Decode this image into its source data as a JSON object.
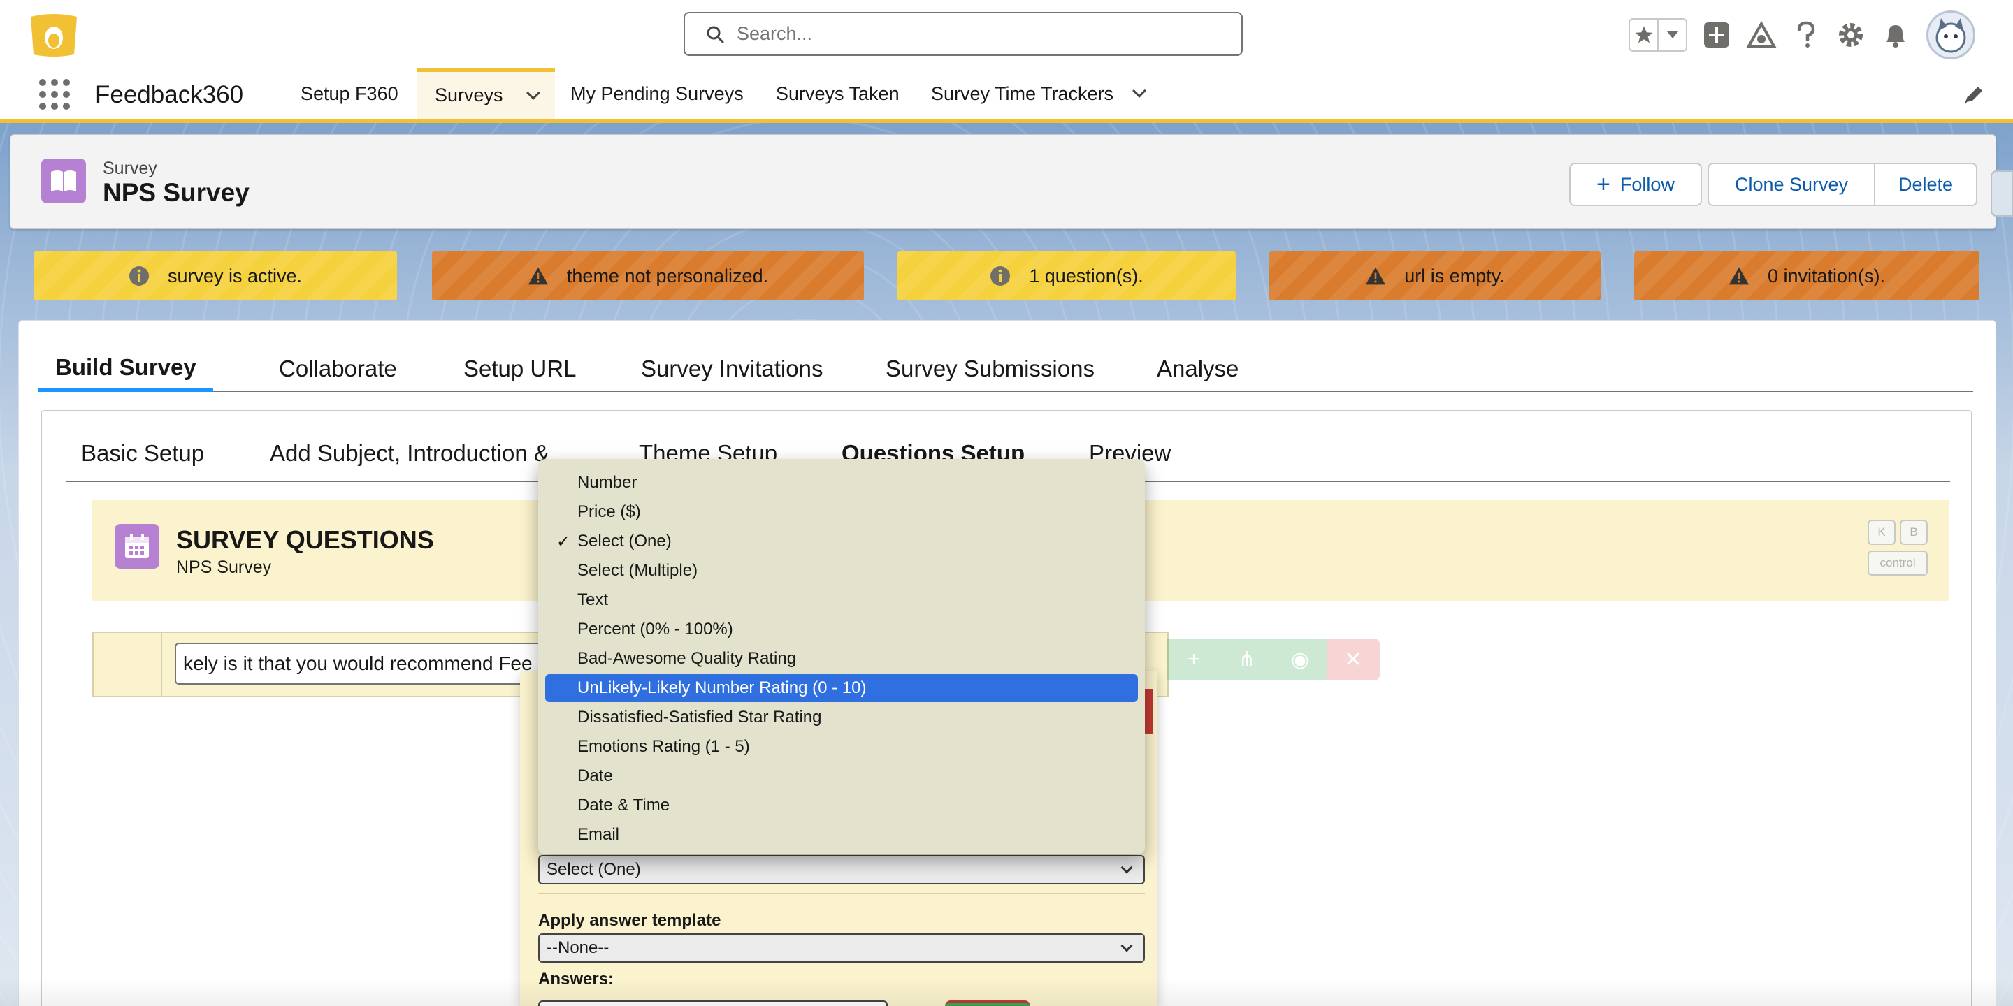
{
  "header": {
    "search_placeholder": "Search..."
  },
  "nav": {
    "app_name": "Feedback360",
    "items": [
      {
        "label": "Setup F360"
      },
      {
        "label": "Surveys"
      },
      {
        "label": "My Pending Surveys"
      },
      {
        "label": "Surveys Taken"
      },
      {
        "label": "Survey Time Trackers"
      }
    ]
  },
  "record": {
    "type": "Survey",
    "title": "NPS Survey",
    "follow": "Follow",
    "clone": "Clone Survey",
    "delete": "Delete"
  },
  "banners": [
    {
      "text": "survey is active.",
      "kind": "info"
    },
    {
      "text": "theme not personalized.",
      "kind": "warn"
    },
    {
      "text": "1 question(s).",
      "kind": "info"
    },
    {
      "text": "url is empty.",
      "kind": "warn"
    },
    {
      "text": "0 invitation(s).",
      "kind": "warn"
    }
  ],
  "tabs": [
    "Build Survey",
    "Collaborate",
    "Setup URL",
    "Survey Invitations",
    "Survey Submissions",
    "Analyse"
  ],
  "subtabs": [
    "Basic Setup",
    "Add Subject, Introduction &",
    "Theme Setup",
    "Questions Setup",
    "Preview"
  ],
  "questions_panel": {
    "title": "SURVEY QUESTIONS",
    "subtitle": "NPS Survey",
    "kbd_k": "K",
    "kbd_b": "B",
    "kbd_control": "control"
  },
  "question": {
    "text": "kely is it that you would recommend Fee"
  },
  "editor": {
    "type_value": "Select (One)",
    "template_label": "Apply answer template",
    "template_value": "--None--",
    "answers_label": "Answers:"
  },
  "dropdown": {
    "options": [
      "Number",
      "Price ($)",
      "Select (One)",
      "Select (Multiple)",
      "Text",
      "Percent (0% - 100%)",
      "Bad-Awesome Quality Rating",
      "UnLikely-Likely Number Rating (0 - 10)",
      "Dissatisfied-Satisfied Star Rating",
      "Emotions Rating (1 - 5)",
      "Date",
      "Date & Time",
      "Email"
    ],
    "checked": "Select (One)",
    "highlighted": "UnLikely-Likely Number Rating (0 - 10)"
  },
  "colors": {
    "accent": "#1b96ff",
    "nav_accent": "#f2c033",
    "info_banner": "#f5d13d",
    "warn_banner": "#da7c2e",
    "record_icon": "#b781d3",
    "highlight": "#2f6fe0"
  }
}
